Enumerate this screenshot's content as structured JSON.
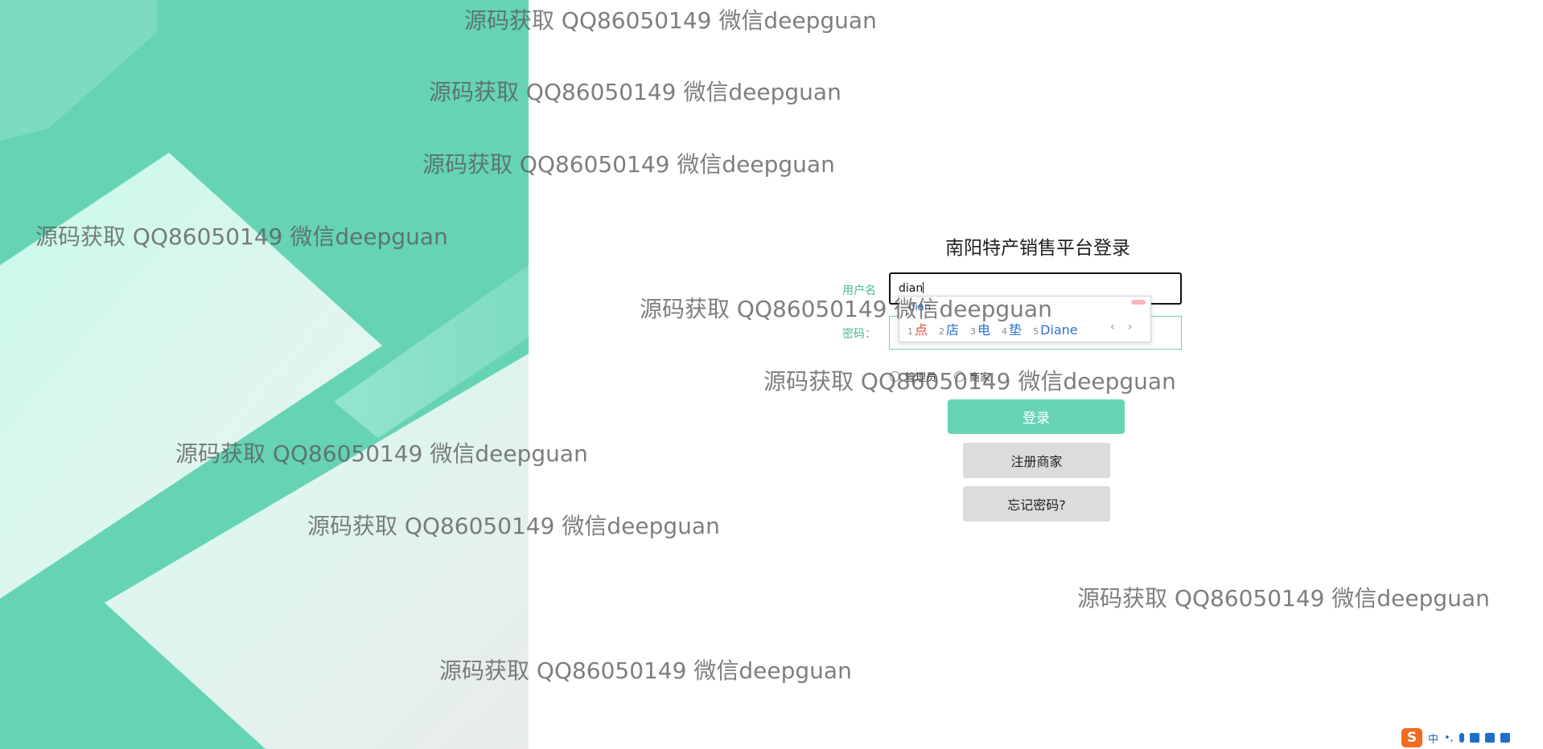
{
  "login": {
    "title": "南阳特产销售平台登录",
    "username_label": "用户名",
    "username_value": "dian",
    "password_label": "密码：",
    "remember_options": [
      "管理员",
      "商家"
    ],
    "login_button": "登录",
    "register_button": "注册商家",
    "forgot_button": "忘记密码?"
  },
  "ime": {
    "composition": "dian",
    "candidates": [
      {
        "num": "1",
        "word": "点"
      },
      {
        "num": "2",
        "word": "店"
      },
      {
        "num": "3",
        "word": "电"
      },
      {
        "num": "4",
        "word": "垫"
      },
      {
        "num": "5",
        "word": "Diane"
      }
    ],
    "arrows": "‹ ›"
  },
  "watermark_text": "源码获取 QQ86050149 微信deepguan",
  "tray": {
    "ime_logo": "S",
    "mode": "中",
    "punct": "•,",
    "icons": [
      "mic-icon",
      "keyboard-icon",
      "skin-icon",
      "toolbox-icon"
    ]
  },
  "colors": {
    "accent": "#66d4b4",
    "panel_light": "#d8fbf1",
    "grey_button": "#dcdcdc",
    "ime_orange": "#f26b21"
  }
}
